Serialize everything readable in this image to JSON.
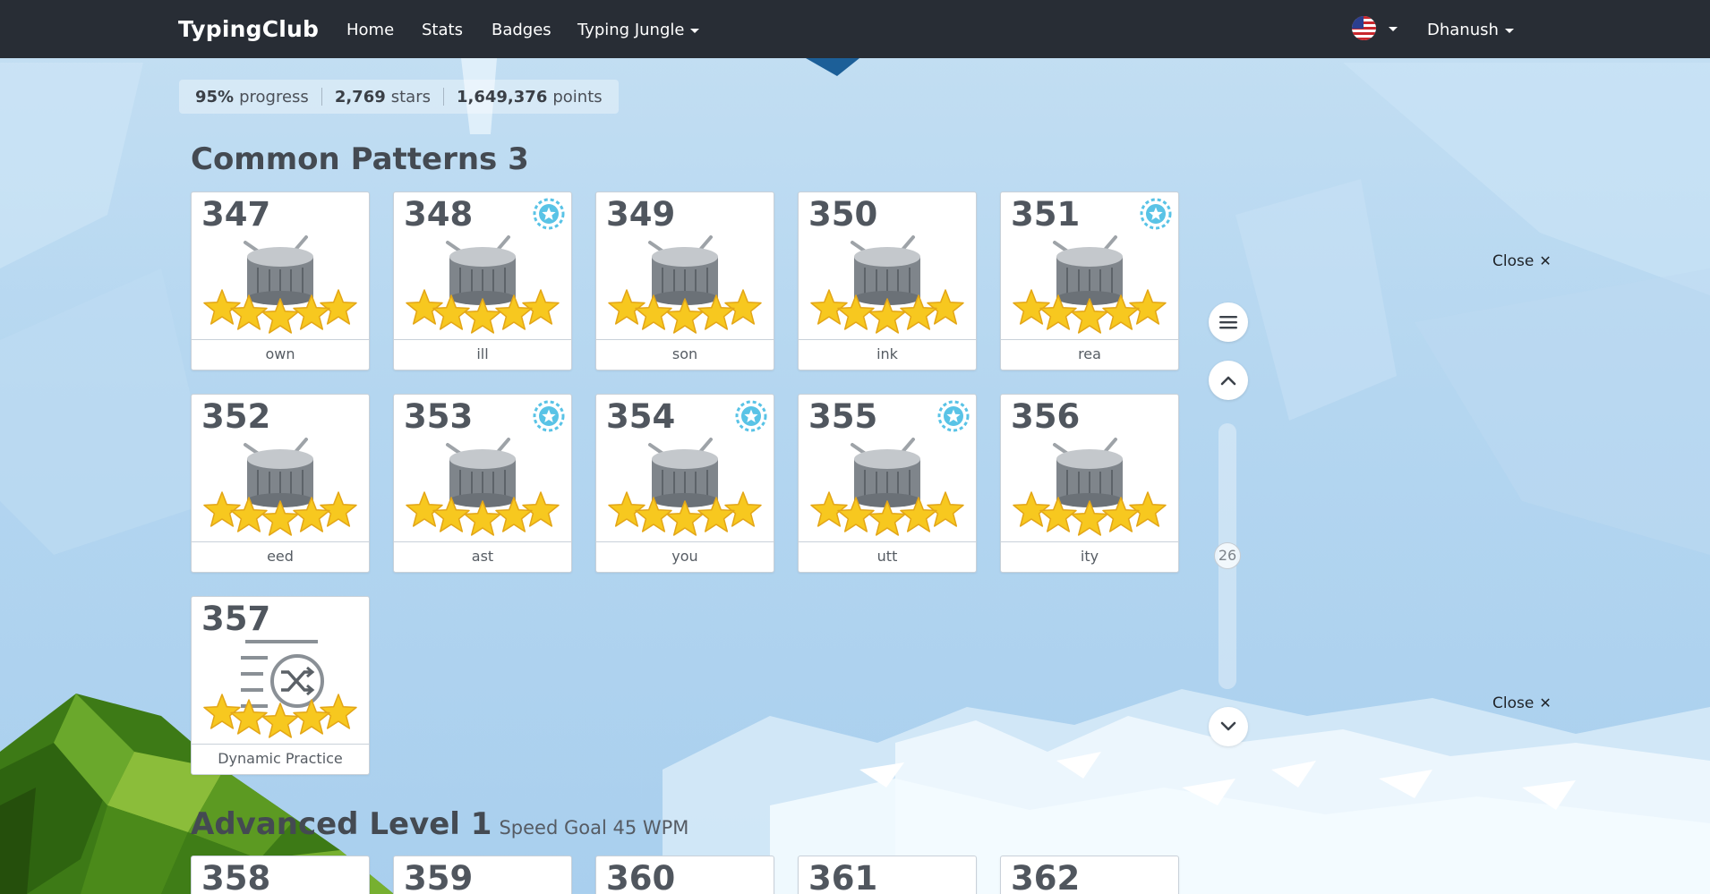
{
  "nav": {
    "brand": "TypingClub",
    "links": [
      "Home",
      "Stats",
      "Badges",
      "Typing Jungle"
    ],
    "user": "Dhanush",
    "flag_icon": "us-flag-icon"
  },
  "stats": {
    "progress_value": "95%",
    "progress_label": "progress",
    "stars_value": "2,769",
    "stars_label": "stars",
    "points_value": "1,649,376",
    "points_label": "points"
  },
  "section1": {
    "title": "Common Patterns 3",
    "lessons": [
      {
        "num": "347",
        "label": "own",
        "icon": "drum-icon",
        "stars": 5,
        "badge": false
      },
      {
        "num": "348",
        "label": "ill",
        "icon": "drum-icon",
        "stars": 5,
        "badge": true
      },
      {
        "num": "349",
        "label": "son",
        "icon": "drum-icon",
        "stars": 5,
        "badge": false
      },
      {
        "num": "350",
        "label": "ink",
        "icon": "drum-icon",
        "stars": 5,
        "badge": false
      },
      {
        "num": "351",
        "label": "rea",
        "icon": "drum-icon",
        "stars": 5,
        "badge": true
      },
      {
        "num": "352",
        "label": "eed",
        "icon": "drum-icon",
        "stars": 5,
        "badge": false
      },
      {
        "num": "353",
        "label": "ast",
        "icon": "drum-icon",
        "stars": 5,
        "badge": true
      },
      {
        "num": "354",
        "label": "you",
        "icon": "drum-icon",
        "stars": 5,
        "badge": true
      },
      {
        "num": "355",
        "label": "utt",
        "icon": "drum-icon",
        "stars": 5,
        "badge": true
      },
      {
        "num": "356",
        "label": "ity",
        "icon": "drum-icon",
        "stars": 5,
        "badge": false
      },
      {
        "num": "357",
        "label": "Dynamic Practice",
        "icon": "shuffle-list-icon",
        "stars": 5,
        "badge": false
      }
    ]
  },
  "section2": {
    "title": "Advanced Level 1",
    "subtitle": "Speed Goal 45 WPM",
    "lessons": [
      {
        "num": "358"
      },
      {
        "num": "359"
      },
      {
        "num": "360"
      },
      {
        "num": "361"
      },
      {
        "num": "362"
      }
    ]
  },
  "controls": {
    "close_label": "Close",
    "close_symbol": "✕",
    "scroll_position": "26"
  },
  "colors": {
    "navbar": "#282d35",
    "star": "#f7c81f",
    "badge": "#59c3e6",
    "sky": "#b4d6f0",
    "mountain": "#4a8c1c"
  }
}
